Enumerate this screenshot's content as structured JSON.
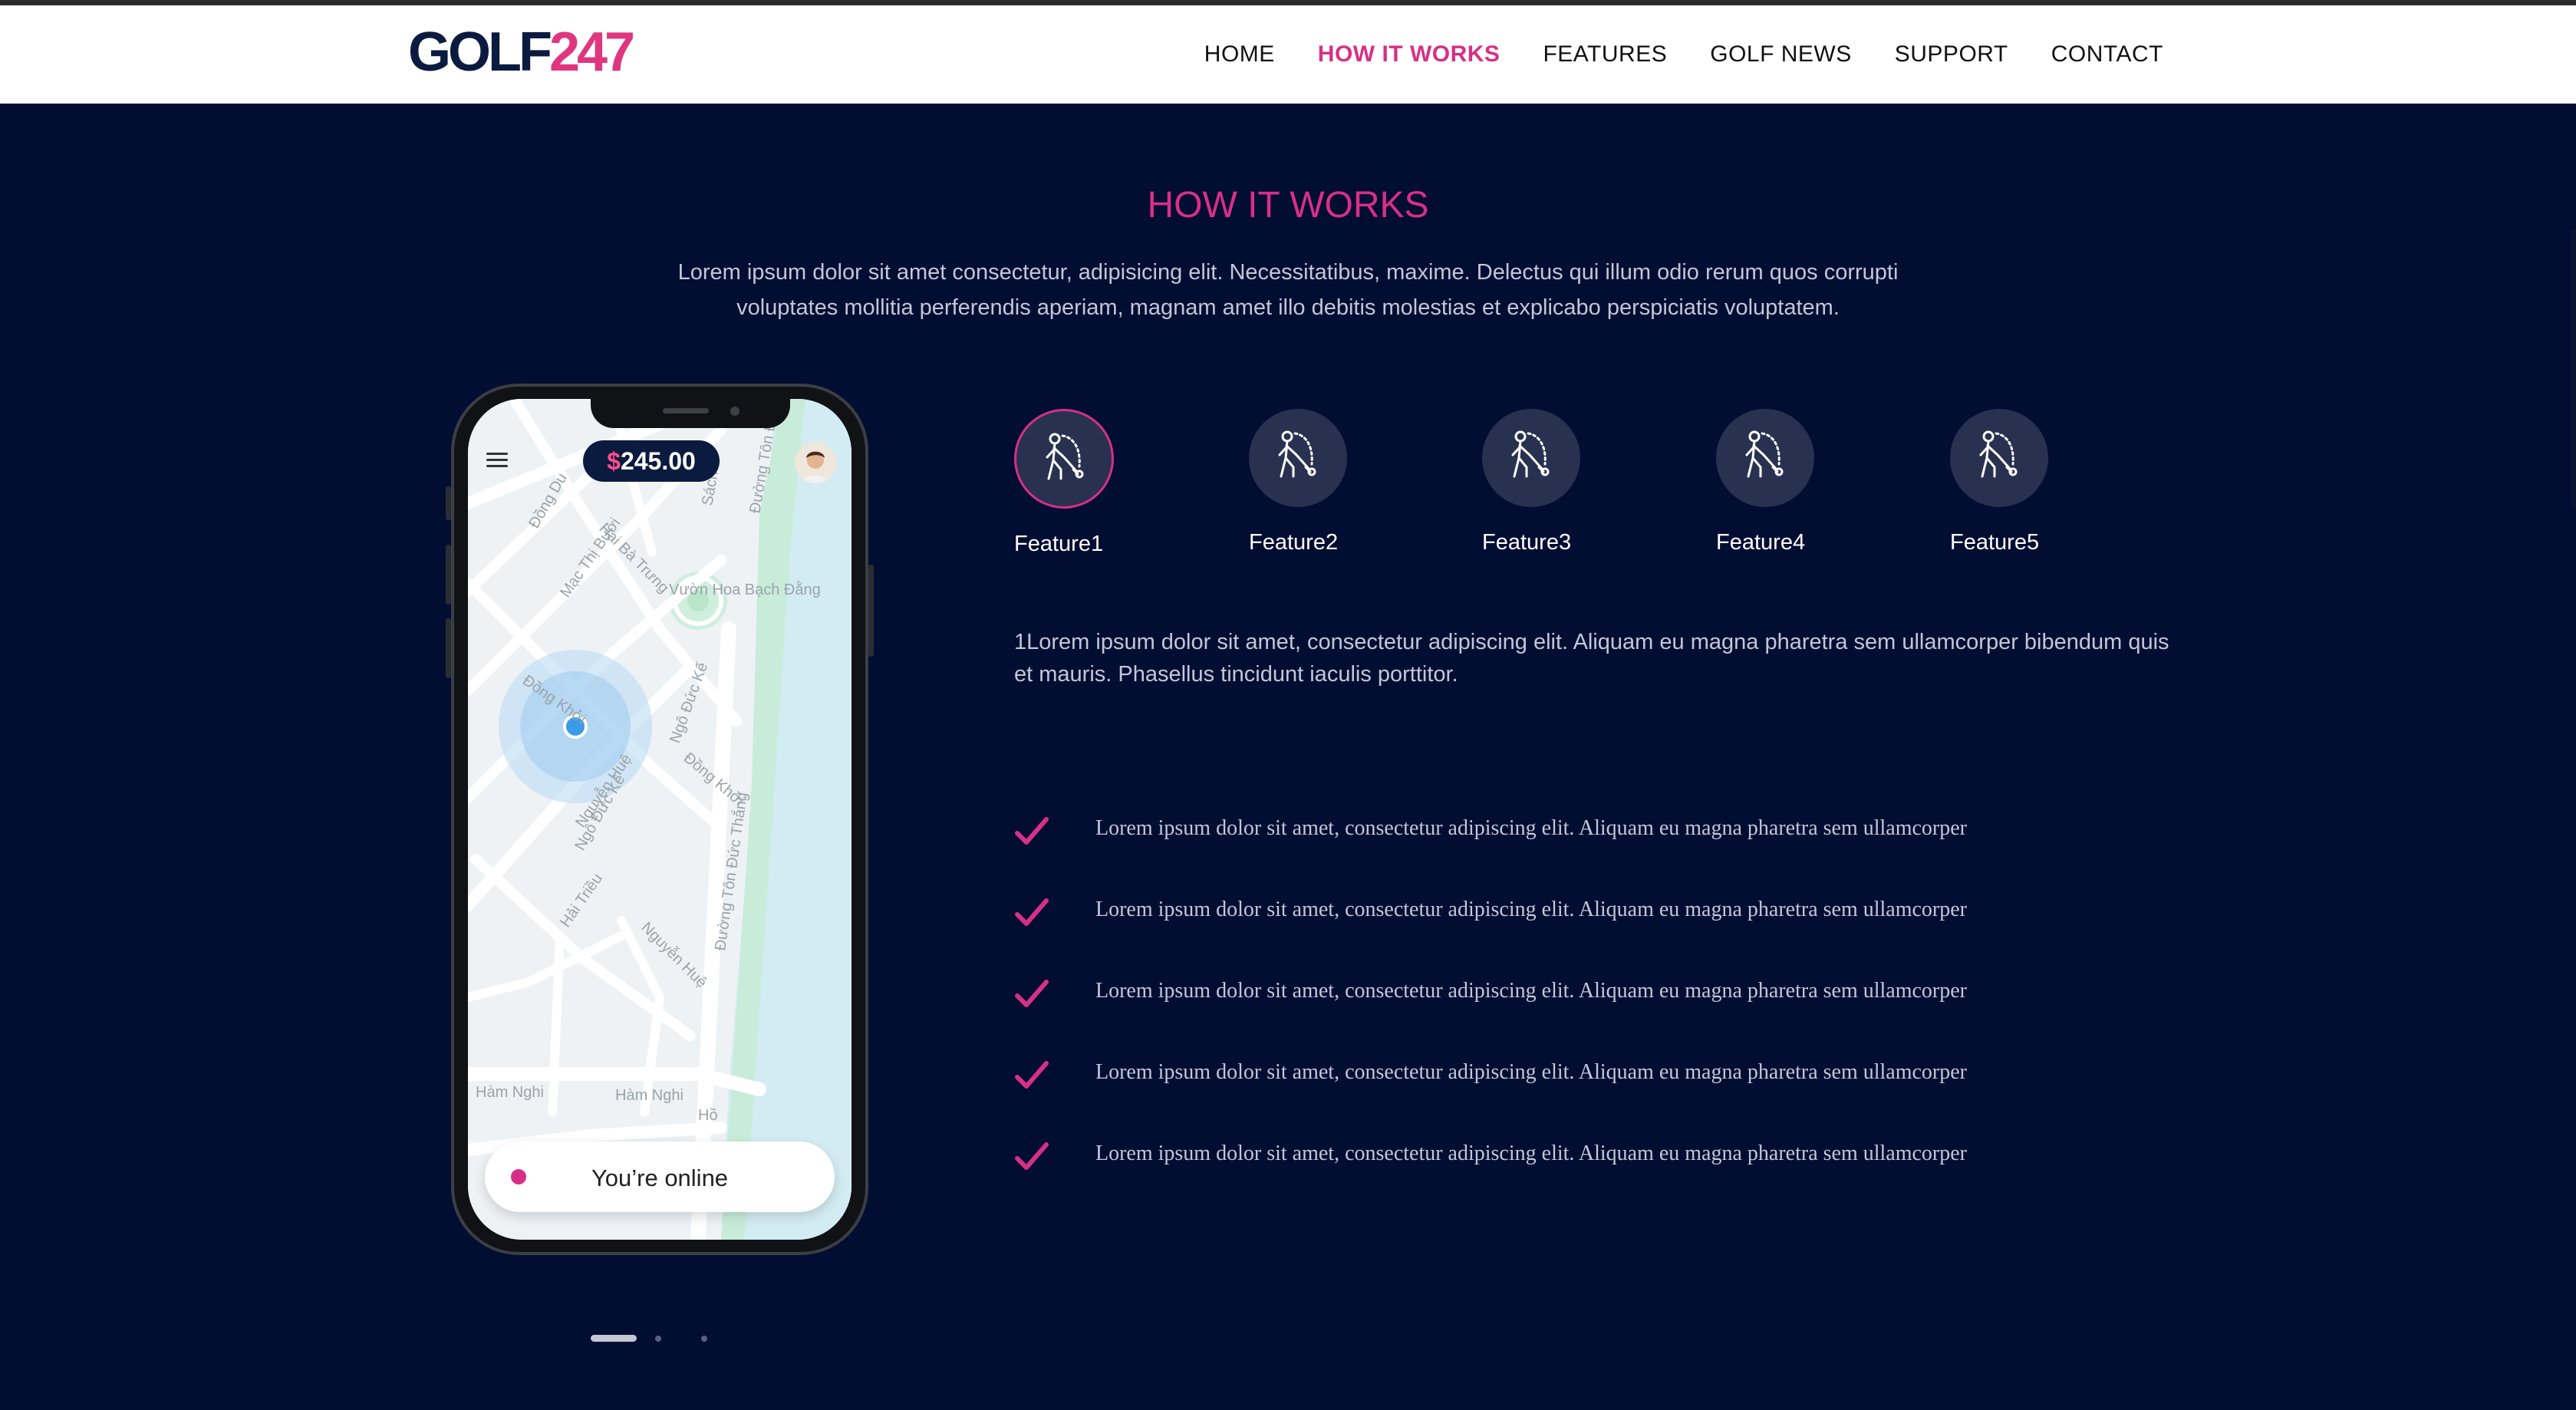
{
  "brand": {
    "logo_main": "GOLF",
    "logo_num": "247",
    "accent": "#d82f86",
    "background": "#020d32"
  },
  "nav": {
    "items": [
      {
        "label": "HOME",
        "active": false
      },
      {
        "label": "HOW IT WORKS",
        "active": true
      },
      {
        "label": "FEATURES",
        "active": false
      },
      {
        "label": "GOLF NEWS",
        "active": false
      },
      {
        "label": "SUPPORT",
        "active": false
      },
      {
        "label": "CONTACT",
        "active": false
      }
    ]
  },
  "section": {
    "title": "HOW IT WORKS",
    "intro": "Lorem ipsum dolor sit amet consectetur, adipisicing elit. Necessitatibus, maxime. Delectus qui illum odio rerum quos corrupti voluptates mollitia perferendis aperiam, magnam amet illo debitis molestias et explicabo perspiciatis voluptatem."
  },
  "phone": {
    "balance_symbol": "$",
    "balance_amount": "245.00",
    "status": "You’re online",
    "map_labels": [
      "Đường Tôn Đức",
      "Hai Bà Trưng",
      "Đồng Du",
      "Mạc Thị Bưởi",
      "Vườn Hoa Bạch Đằng",
      "Đồng Khởi",
      "Ngô Đức Kế",
      "Nguyễn Huệ",
      "Đường Tôn Đức Thắng",
      "Hải Triều",
      "Hàm Nghi",
      "Hàm Nghi",
      "Hồ",
      "Sách"
    ]
  },
  "carousel": {
    "total": 3,
    "active_index": 0
  },
  "features": [
    {
      "label": "Feature1",
      "icon": "golfer-icon",
      "active": true
    },
    {
      "label": "Feature2",
      "icon": "golfer-icon",
      "active": false
    },
    {
      "label": "Feature3",
      "icon": "golfer-icon",
      "active": false
    },
    {
      "label": "Feature4",
      "icon": "golfer-icon",
      "active": false
    },
    {
      "label": "Feature5",
      "icon": "golfer-icon",
      "active": false
    }
  ],
  "feature_description": "1Lorem ipsum dolor sit amet, consectetur adipiscing elit. Aliquam eu magna pharetra sem ullamcorper bibendum quis et mauris. Phasellus tincidunt iaculis porttitor.",
  "checklist": [
    "Lorem ipsum dolor sit amet, consectetur adipiscing elit. Aliquam eu magna pharetra sem ullamcorper",
    "Lorem ipsum dolor sit amet, consectetur adipiscing elit. Aliquam eu magna pharetra sem ullamcorper",
    "Lorem ipsum dolor sit amet, consectetur adipiscing elit. Aliquam eu magna pharetra sem ullamcorper",
    "Lorem ipsum dolor sit amet, consectetur adipiscing elit. Aliquam eu magna pharetra sem ullamcorper",
    "Lorem ipsum dolor sit amet, consectetur adipiscing elit. Aliquam eu magna pharetra sem ullamcorper"
  ]
}
